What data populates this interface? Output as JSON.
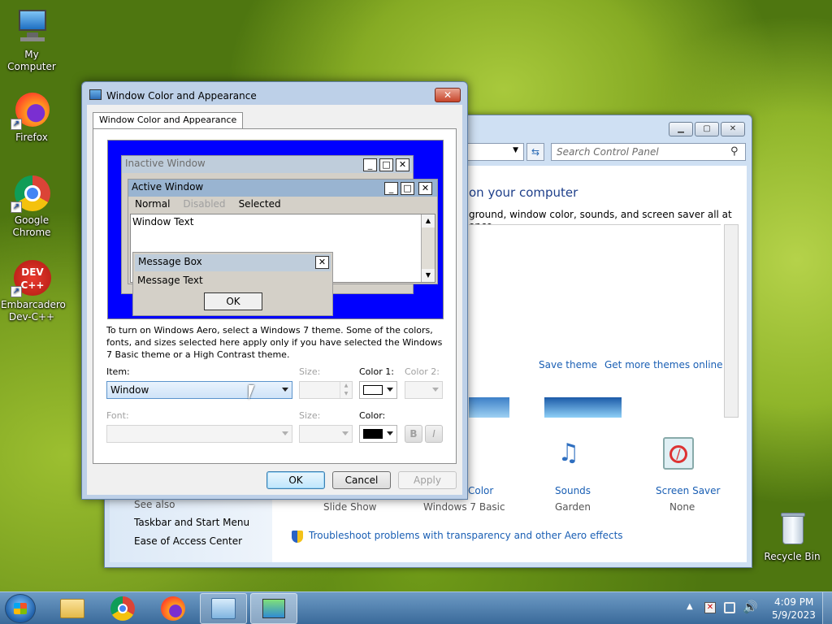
{
  "desktop": {
    "icons": [
      {
        "label": "My Computer"
      },
      {
        "label": "Firefox"
      },
      {
        "label": "Google Chrome"
      },
      {
        "label": "Embarcadero Dev-C++",
        "logo_text": "DEV C++"
      },
      {
        "label": "Recycle Bin"
      }
    ]
  },
  "control_panel": {
    "search_placeholder": "Search Control Panel",
    "heading": "on your computer",
    "subheading": "ground, window color, sounds, and screen saver all at once.",
    "save_theme": "Save theme",
    "get_more_themes": "Get more themes online",
    "see_also_title": "See also",
    "see_also_links": [
      "Taskbar and Start Menu",
      "Ease of Access Center"
    ],
    "bottom_items": [
      {
        "title": "Color",
        "value": "Windows 7 Basic"
      },
      {
        "title": "Sounds",
        "value": "Garden"
      },
      {
        "title": "Screen Saver",
        "value": "None"
      }
    ],
    "desktop_bg_value": "Slide Show",
    "troubleshoot": "Troubleshoot problems with transparency and other Aero effects"
  },
  "dialog": {
    "title": "Window Color and Appearance",
    "close_symbol": "✕",
    "tab_label": "Window Color and Appearance",
    "preview": {
      "inactive_title": "Inactive Window",
      "active_title": "Active Window",
      "menu_normal": "Normal",
      "menu_disabled": "Disabled",
      "menu_selected": "Selected",
      "window_text": "Window Text",
      "msgbox_title": "Message Box",
      "msgbox_text": "Message Text",
      "msgbox_ok": "OK"
    },
    "description": "To turn on Windows Aero, select a Windows 7 theme.  Some of the colors, fonts, and sizes selected here apply only if you have selected the Windows 7 Basic theme or a High Contrast theme.",
    "item_label": "Item:",
    "item_value": "Window",
    "size1_label": "Size:",
    "color1_label": "Color 1:",
    "color1_value": "#ffffff",
    "color2_label": "Color 2:",
    "font_label": "Font:",
    "size2_label": "Size:",
    "color_label": "Color:",
    "color_value": "#000000",
    "bold_label": "B",
    "italic_label": "I",
    "ok": "OK",
    "cancel": "Cancel",
    "apply": "Apply"
  },
  "taskbar": {
    "time": "4:09 PM",
    "date": "5/9/2023"
  }
}
